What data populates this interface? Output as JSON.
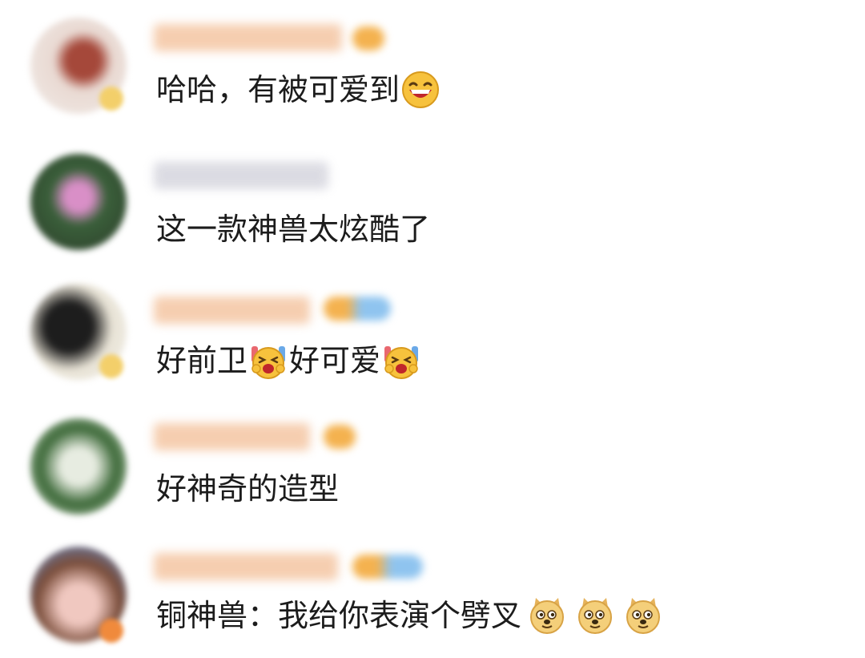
{
  "comments": [
    {
      "text": "哈哈，有被可爱到",
      "emojis": [
        "laughing-face"
      ],
      "avatar_colors": [
        "#e9d9d2",
        "#a5483a",
        "#f3cf6a"
      ],
      "name_color": "#f5c9a8",
      "badge_color": "#f4b24f"
    },
    {
      "text": "这一款神兽太炫酷了",
      "emojis": [],
      "avatar_colors": [
        "#3a5f3a",
        "#d98fc7",
        "#2c3d2a"
      ],
      "name_color": "#d8d8e0",
      "badge_color": ""
    },
    {
      "text_part1": "好前卫",
      "text_part2": "好可爱",
      "emojis": [
        "cheering-face",
        "cheering-face"
      ],
      "avatar_colors": [
        "#1d1d1d",
        "#e8e3d6",
        "#f3cf6a"
      ],
      "name_color": "#f5c9a8",
      "badge_color": "#8fc4ef"
    },
    {
      "text": "好神奇的造型",
      "emojis": [],
      "avatar_colors": [
        "#e7ece1",
        "#3f6b3b",
        "#c9d6c2"
      ],
      "name_color": "#f5c9a8",
      "badge_color": "#f4b24f"
    },
    {
      "text": "铜神兽：我给你表演个劈叉",
      "emojis": [
        "doge-face",
        "doge-face",
        "doge-face"
      ],
      "avatar_colors": [
        "#7a4d3a",
        "#f0c8c0",
        "#5b8fd6"
      ],
      "name_color": "#f5c9a8",
      "badge_color": "#8fc4ef"
    }
  ]
}
